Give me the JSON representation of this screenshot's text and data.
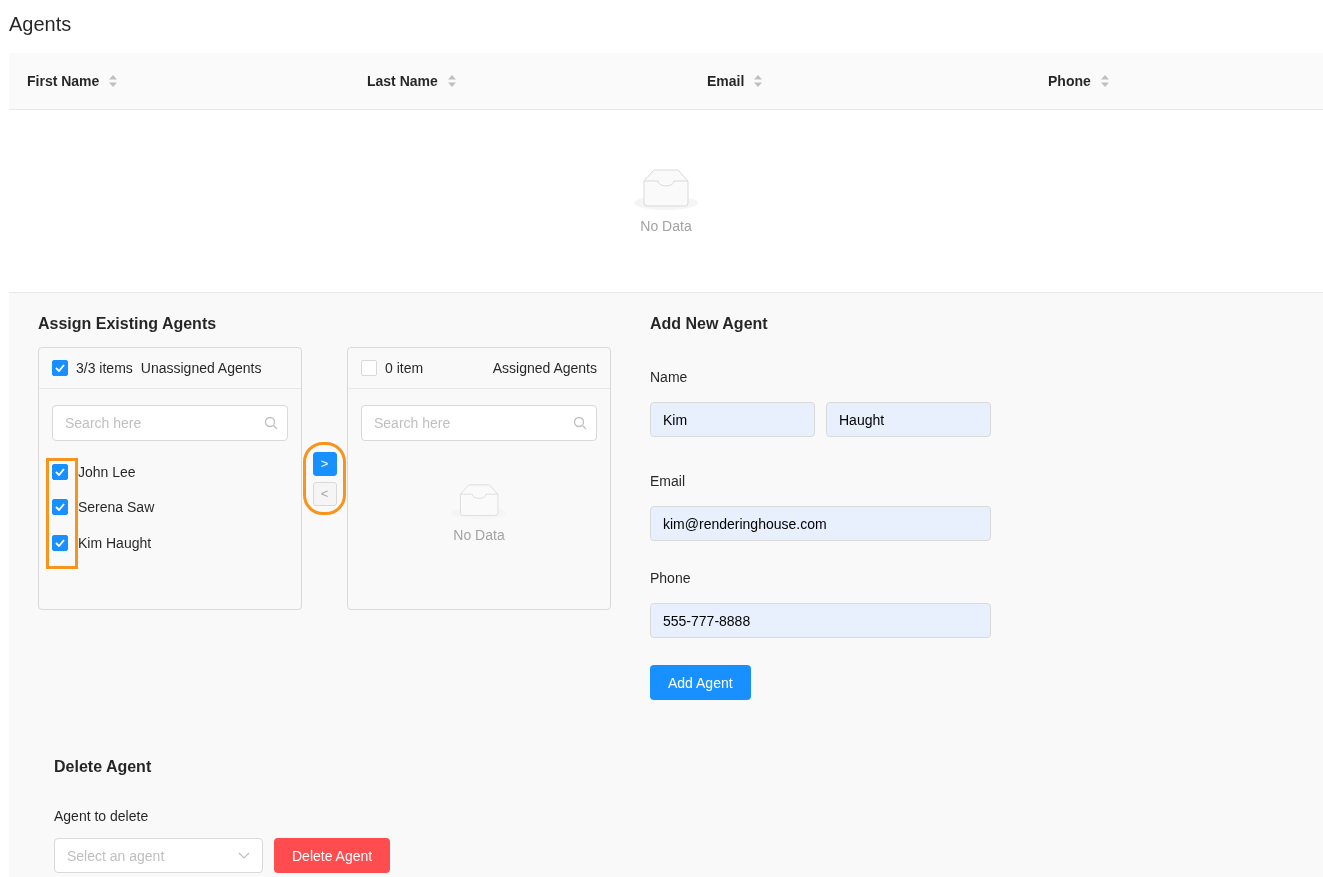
{
  "title": "Agents",
  "table": {
    "columns": [
      "First Name",
      "Last Name",
      "Email",
      "Phone"
    ],
    "empty_text": "No Data"
  },
  "assign": {
    "heading": "Assign Existing Agents",
    "source": {
      "checked": true,
      "count": "3/3 items",
      "title": "Unassigned Agents",
      "search_placeholder": "Search here",
      "items": [
        {
          "name": "John Lee",
          "checked": true
        },
        {
          "name": "Serena Saw",
          "checked": true
        },
        {
          "name": "Kim Haught",
          "checked": true
        }
      ]
    },
    "transfer_buttons": [
      {
        "label": ">",
        "disabled": false
      },
      {
        "label": "<",
        "disabled": true
      }
    ],
    "target": {
      "checked": false,
      "count": "0 item",
      "title": "Assigned Agents",
      "search_placeholder": "Search here",
      "empty_text": "No Data"
    }
  },
  "add": {
    "heading": "Add New Agent",
    "name_label": "Name",
    "first_name": "Kim",
    "last_name": "Haught",
    "email_label": "Email",
    "email": "kim@renderinghouse.com",
    "phone_label": "Phone",
    "phone": "555-777-8888",
    "button": "Add Agent"
  },
  "delete": {
    "heading": "Delete Agent",
    "label": "Agent to delete",
    "placeholder": "Select an agent",
    "button": "Delete Agent"
  }
}
